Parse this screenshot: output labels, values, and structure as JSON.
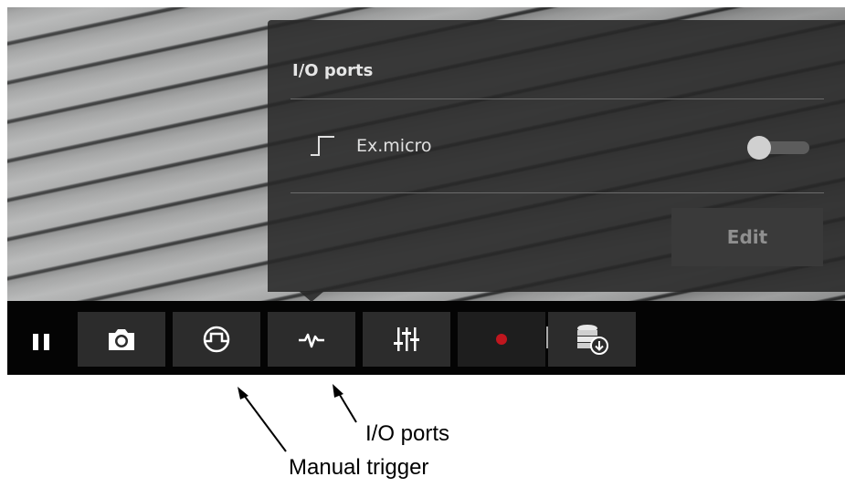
{
  "io_panel": {
    "title": "I/O ports",
    "ports": [
      {
        "icon": "input-port-icon",
        "label": "Ex.micro",
        "toggle_on": false
      }
    ],
    "edit_label": "Edit"
  },
  "toolbar": {
    "buttons": [
      "pause-icon",
      "camera-icon",
      "manual-trigger-icon",
      "io-ports-icon",
      "adjust-sliders-icon",
      "record-icon",
      "storage-download-icon"
    ]
  },
  "annotations": {
    "io_ports": "I/O ports",
    "manual_trigger": "Manual trigger"
  },
  "colors": {
    "record": "#c0161e",
    "panel": "#282828",
    "toolbar": "#040404"
  }
}
